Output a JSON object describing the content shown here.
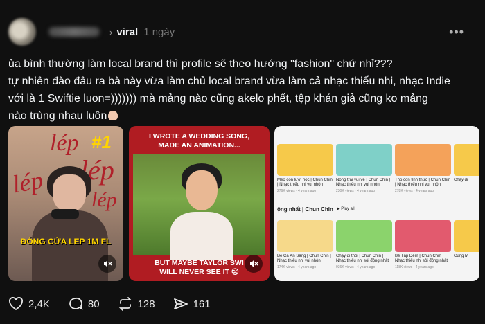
{
  "post": {
    "tag": "viral",
    "time": "1 ngày",
    "lines": [
      "ủa bình thường làm local brand thì profile sẽ theo hướng \"fashion\" chứ nhỉ???",
      "tự nhiên đào đâu ra bà này vừa làm chủ local brand vừa làm cả nhạc thiếu nhi, nhạc Indie",
      "với là 1 Swiftie luon=))))))) mà mảng nào cũng akelo phết, tệp khán giả cũng ko mảng",
      "nào trùng nhau luôn"
    ]
  },
  "media": {
    "m1": {
      "overlay_words": [
        "lép",
        "lép",
        "lép",
        "lép"
      ],
      "badge": "#1",
      "caption": "ĐÓNG CỬA LEP 1M FL"
    },
    "m2": {
      "top_text_1": "I WROTE A WEDDING SONG,",
      "top_text_2": "MADE AN ANIMATION...",
      "bottom_text_1": "BUT MAYBE TAYLOR SWI",
      "bottom_text_2": "WILL NEVER SEE IT"
    },
    "m3": {
      "section_header": "ộng nhất | Chun Chin",
      "play_all": "Play all",
      "row1": [
        {
          "title": "Meo con lười học | Chun Chin | Nhạc thiếu nhi vui nhộn",
          "stats": "276K views · 4 years ago",
          "color": "#f6c94a"
        },
        {
          "title": "Nồng trại vui vẻ | Chun Chin | Nhạc thiếu nhi vui nhộn",
          "stats": "230K views · 4 years ago",
          "color": "#7fd0c8"
        },
        {
          "title": "Thỏ con tỉnh thức | Chun Chin | Nhạc thiếu nhi vui nhộn",
          "stats": "278K views · 4 years ago",
          "color": "#f4a25a"
        },
        {
          "title": "Chạy đi",
          "stats": "",
          "color": "#f6c94a"
        }
      ],
      "row2": [
        {
          "title": "Bé Ca Ăn Sáng | Chun Chin | Nhạc thiếu nhi vui nhộn",
          "stats": "174K views · 4 years ago",
          "color": "#f6d98a"
        },
        {
          "title": "Chạy đi thôi | Chun Chin | Nhạc thiếu nhi sôi động nhất",
          "stats": "936K views · 4 years ago",
          "color": "#8bd36c"
        },
        {
          "title": "Bé Tập Đếm | Chun Chin | Nhạc thiếu nhi sôi động nhất",
          "stats": "118K views · 4 years ago",
          "color": "#e25a6e"
        },
        {
          "title": "Cùng M",
          "stats": "",
          "color": "#f6c94a"
        }
      ]
    }
  },
  "actions": {
    "likes": "2,4K",
    "comments": "80",
    "reposts": "128",
    "shares": "161"
  },
  "colors": {
    "background": "#101010",
    "text": "#f3f5f7",
    "muted": "#777777",
    "m2_red": "#b01c22",
    "caption_yellow": "#ffd400"
  }
}
